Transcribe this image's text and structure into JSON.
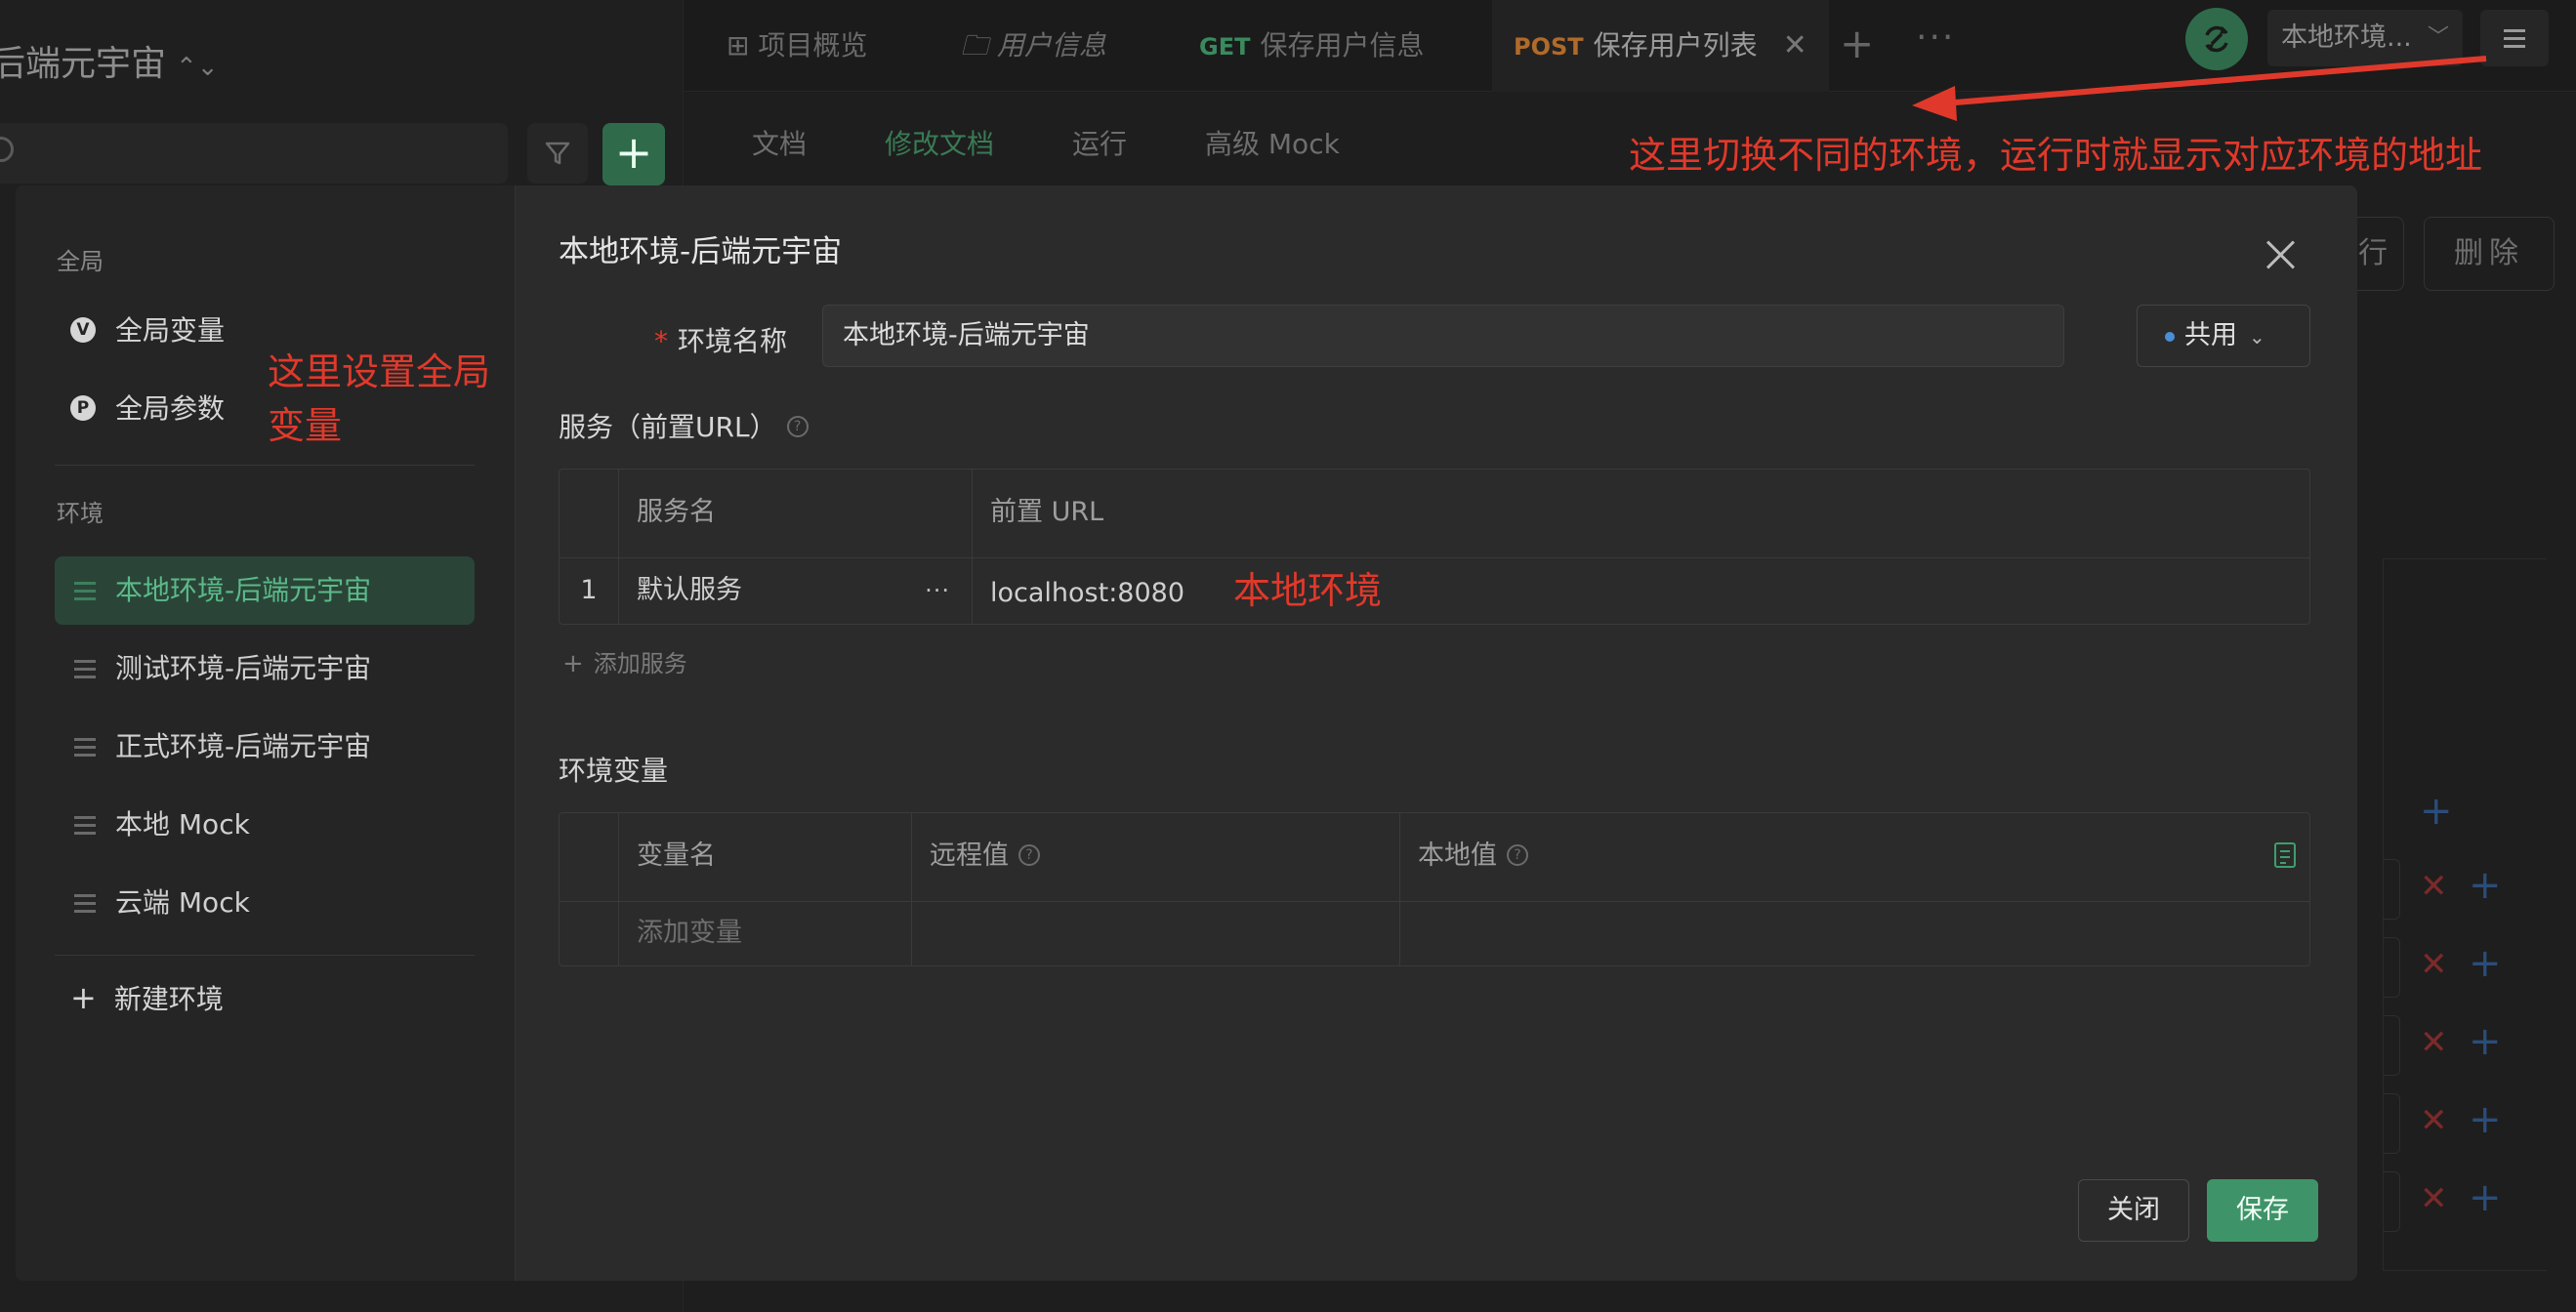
{
  "project": {
    "title": "后端元宇宙",
    "switch_icon": "up-down-chevron-icon"
  },
  "tabs": [
    {
      "label": "项目概览",
      "icon": "grid-icon"
    },
    {
      "label": "用户信息",
      "icon": "folder-icon"
    },
    {
      "method": "GET",
      "label": "保存用户信息"
    },
    {
      "method": "POST",
      "label": "保存用户列表",
      "close": "✕"
    }
  ],
  "tab_actions": {
    "add": "+",
    "more": "···"
  },
  "topbar": {
    "env_selector": "本地环境..."
  },
  "subtabs": [
    "文档",
    "修改文档",
    "运行",
    "高级 Mock"
  ],
  "bg_actions": {
    "run": "行",
    "delete": "删除"
  },
  "annotations": {
    "env_switch": "这里切换不同的环境，运行时就显示对应环境的地址",
    "global_vars": "这里设置全局变量",
    "local_env": "本地环境"
  },
  "sidebar": {
    "global_section": "全局",
    "global_items": [
      {
        "badge": "V",
        "label": "全局变量"
      },
      {
        "badge": "P",
        "label": "全局参数"
      }
    ],
    "env_section": "环境",
    "environments": [
      {
        "label": "本地环境-后端元宇宙",
        "active": true
      },
      {
        "label": "测试环境-后端元宇宙",
        "active": false
      },
      {
        "label": "正式环境-后端元宇宙",
        "active": false
      },
      {
        "label": "本地 Mock",
        "active": false
      },
      {
        "label": "云端 Mock",
        "active": false
      }
    ],
    "new_env": "新建环境"
  },
  "dialog": {
    "title": "本地环境-后端元宇宙",
    "env_name_label": "环境名称",
    "env_name_value": "本地环境-后端元宇宙",
    "share_option": "共用",
    "services_title": "服务（前置URL）",
    "services_table": {
      "headers": [
        "服务名",
        "前置 URL"
      ],
      "rows": [
        {
          "index": "1",
          "name": "默认服务",
          "url": "localhost:8080"
        }
      ]
    },
    "add_service": "添加服务",
    "env_vars_title": "环境变量",
    "vars_table": {
      "headers": [
        "变量名",
        "远程值",
        "本地值"
      ],
      "placeholder_row": "添加变量"
    },
    "close_button": "关闭",
    "save_button": "保存"
  },
  "colors": {
    "accent_green": "#3e9468",
    "annotation_red": "#e0392b",
    "post_method": "#b06a2a",
    "get_method": "#3a8a5e"
  }
}
